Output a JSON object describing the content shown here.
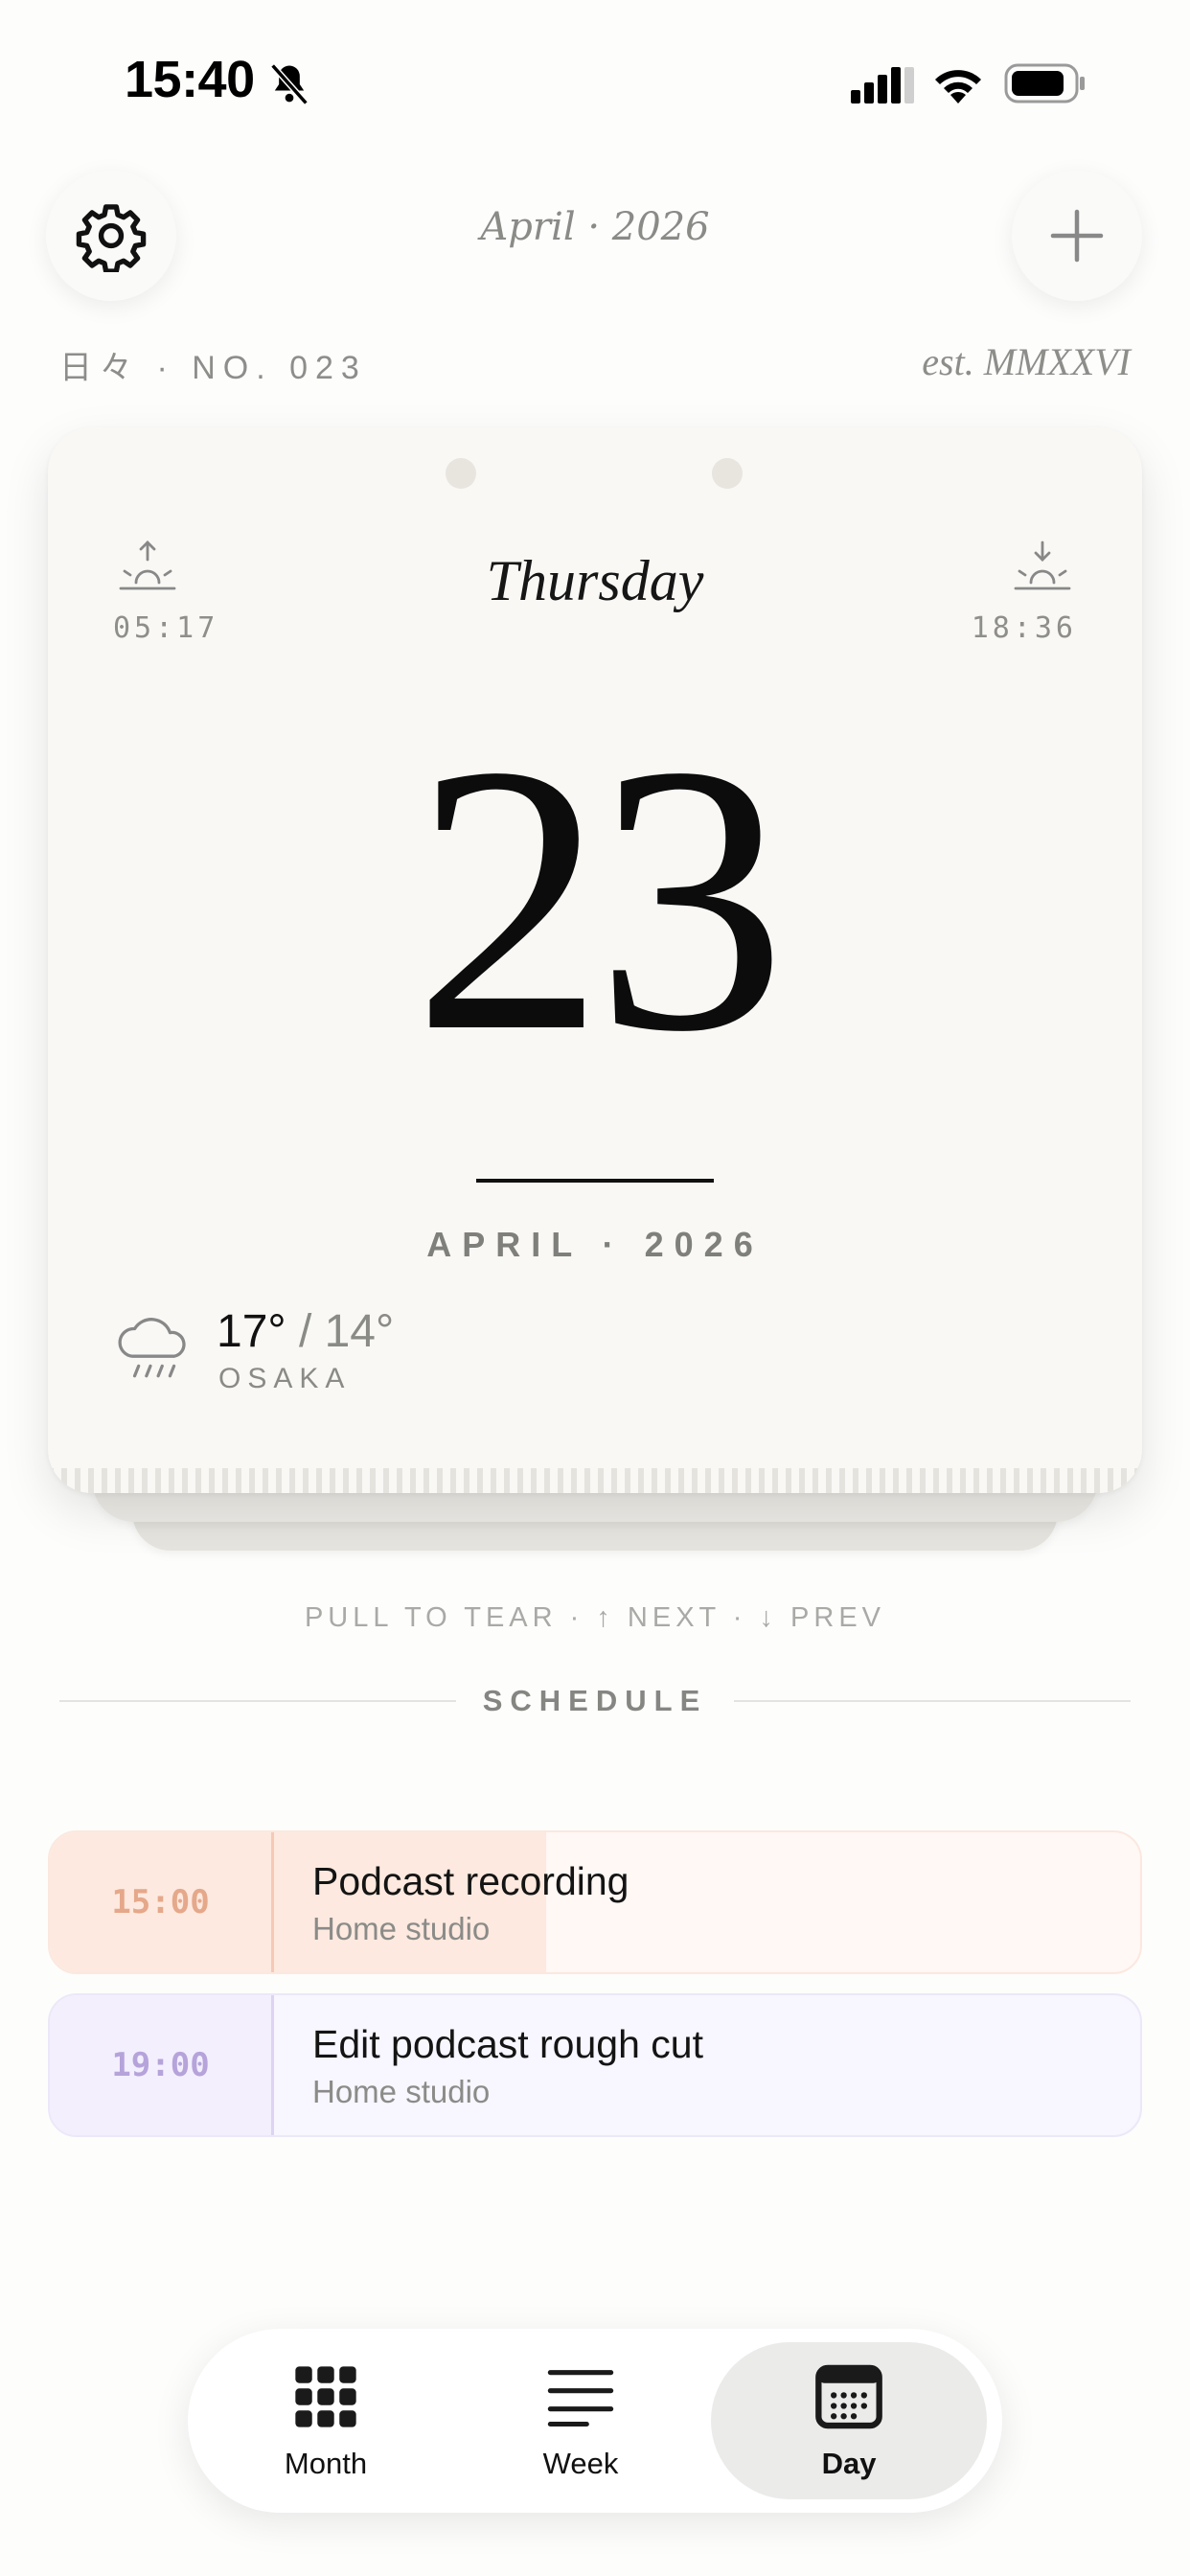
{
  "status_bar": {
    "time": "15:40",
    "icons": [
      "bell-slash-icon",
      "cellular-signal-icon",
      "wifi-icon",
      "battery-icon"
    ]
  },
  "header": {
    "month_label": "April · 2026",
    "issue_label": "日々 · NO. 023",
    "est_label": "est. MMXXVI",
    "settings_icon": "gear-icon",
    "add_icon": "plus-icon"
  },
  "calendar_card": {
    "sunrise": "05:17",
    "sunset": "18:36",
    "weekday": "Thursday",
    "day_number": "23",
    "month_year": "APRIL · 2026",
    "weather": {
      "icon": "rain-cloud-icon",
      "high": "17°",
      "low": "/ 14°",
      "city": "OSAKA"
    }
  },
  "hint": "PULL TO TEAR · ↑ NEXT · ↓ PREV",
  "schedule": {
    "title": "SCHEDULE",
    "events": [
      {
        "time": "15:00",
        "title": "Podcast recording",
        "location": "Home studio",
        "accent": "#e5a88a"
      },
      {
        "time": "19:00",
        "title": "Edit podcast rough cut",
        "location": "Home studio",
        "accent": "#b5a3da"
      }
    ]
  },
  "tab_bar": {
    "tabs": [
      {
        "label": "Month",
        "icon": "grid-icon"
      },
      {
        "label": "Week",
        "icon": "lines-icon"
      },
      {
        "label": "Day",
        "icon": "calendar-day-icon"
      }
    ],
    "selected": "Day"
  }
}
